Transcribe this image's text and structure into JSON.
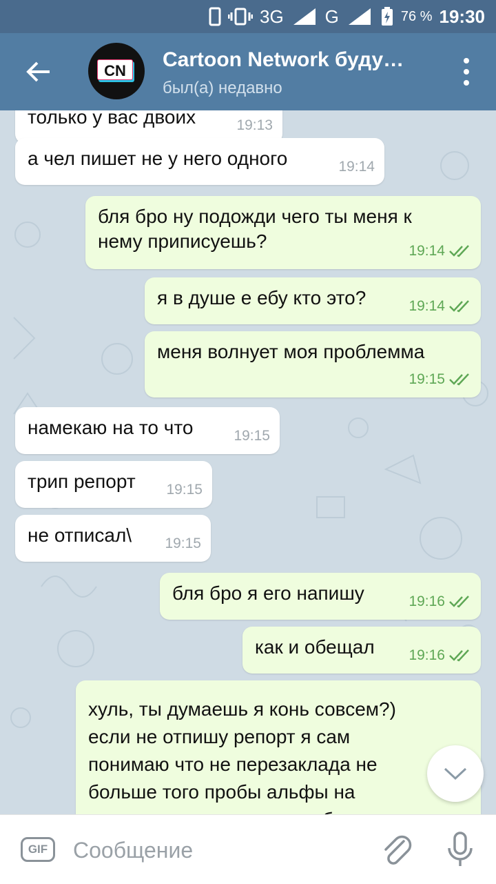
{
  "status_bar": {
    "network1": "3G",
    "network1_sup": "3G",
    "network2": "G",
    "network2_sup": "R",
    "battery": "76 %",
    "time": "19:30"
  },
  "header": {
    "title": "Cartoon Network буду…",
    "subtitle": "был(а) недавно",
    "avatar_text": "CN"
  },
  "messages": [
    {
      "dir": "in",
      "text": "только у вас двоих",
      "time": "19:13"
    },
    {
      "dir": "in",
      "text": "а чел пишет не у него одного",
      "time": "19:14"
    },
    {
      "dir": "out",
      "text": "бля бро ну подожди чего ты меня к\nнему приписуешь?",
      "time": "19:14"
    },
    {
      "dir": "out",
      "text": "я в душе е ебу кто это?",
      "time": "19:14"
    },
    {
      "dir": "out",
      "text": "меня волнует моя проблемма",
      "time": "19:15"
    },
    {
      "dir": "in",
      "text": "намекаю на то что",
      "time": "19:15"
    },
    {
      "dir": "in",
      "text": "трип репорт",
      "time": "19:15"
    },
    {
      "dir": "in",
      "text": "не отписал\\",
      "time": "19:15"
    },
    {
      "dir": "out",
      "text": "бля бро я его напишу",
      "time": "19:16"
    },
    {
      "dir": "out",
      "text": "как и обещал",
      "time": "19:16"
    },
    {
      "dir": "out",
      "text": "хуль, ты думаешь я конь совсем?)\nесли не отпишу репорт я сам\nпонимаю что не перезаклада не\nбольше того пробы альфы на\nкоторые меня записал на будующее",
      "time": ""
    }
  ],
  "input": {
    "gif_label": "GIF",
    "placeholder": "Сообщение"
  },
  "colors": {
    "header": "#527da3",
    "status_bar": "#4a6b8d",
    "incoming_bubble": "#ffffff",
    "outgoing_bubble": "#effdde",
    "read_check": "#5ea755"
  }
}
